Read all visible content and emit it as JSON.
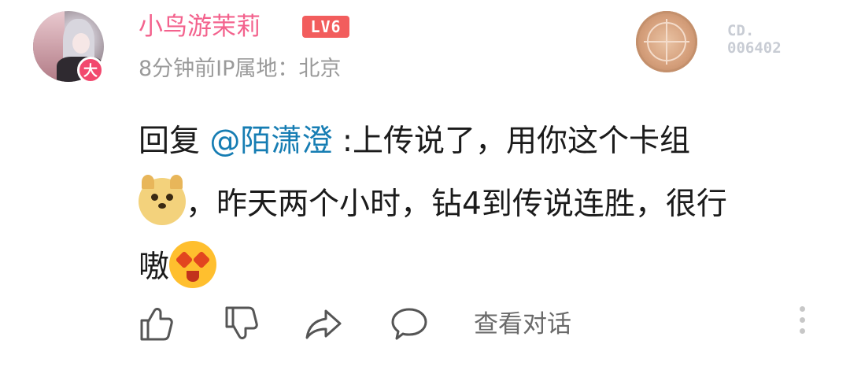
{
  "user": {
    "name": "小鸟游茉莉",
    "level": "LV6",
    "badge": "大",
    "meta": "8分钟前IP属地：北京"
  },
  "medal": {
    "number_line1": "CD.",
    "number_line2": "006402"
  },
  "comment": {
    "prefix": "回复 ",
    "mention": "@陌潇澄",
    "line1_rest": " :上传说了，用你这个卡组",
    "line2": "，昨天两个小时，钻4到传说连胜，很行",
    "line3": "嗷",
    "emoji1": "doge-emoji",
    "emoji2": "starstruck-emoji"
  },
  "actions": {
    "view_thread": "查看对话",
    "icons": [
      "thumbs-up-icon",
      "thumbs-down-icon",
      "share-icon",
      "comment-icon",
      "more-vertical-icon"
    ]
  },
  "colors": {
    "username": "#f3628d",
    "level_bg": "#f25d5d",
    "mention": "#167db3",
    "meta": "#9a9a9a"
  }
}
